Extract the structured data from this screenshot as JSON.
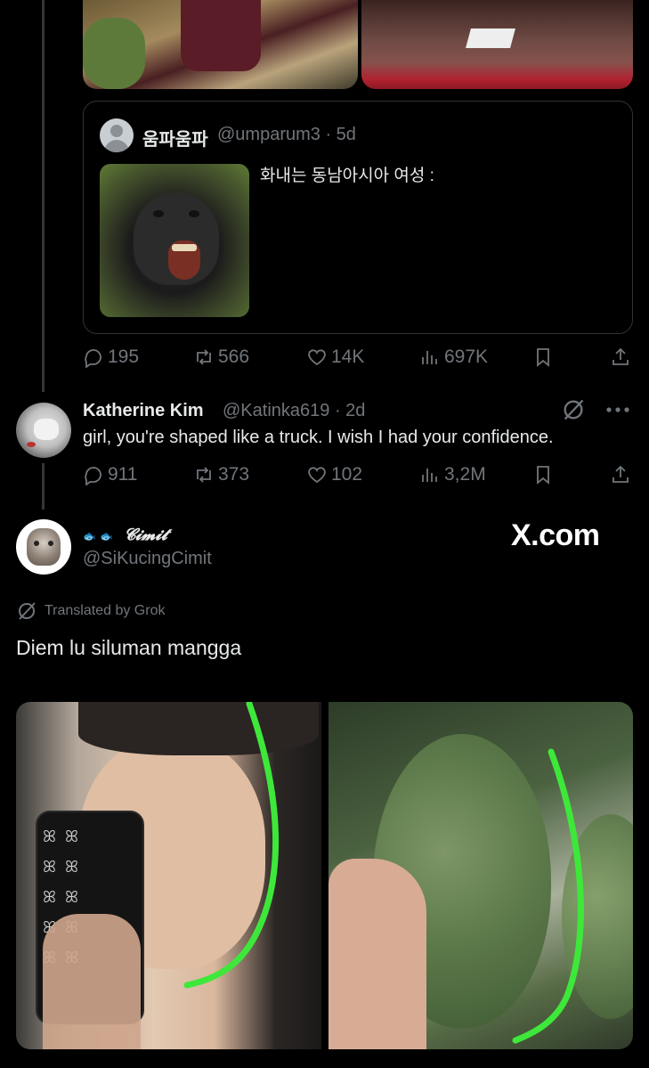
{
  "quote": {
    "name": "움파움파",
    "handle": "@umparum3 · 5d",
    "text": "화내는 동남아시아 여성 :"
  },
  "main_actions": {
    "replies": "195",
    "reposts": "566",
    "likes": "14K",
    "views": "697K"
  },
  "reply1": {
    "name": "Katherine Kim",
    "handle": "@Katinka619 · 2d",
    "text": "girl, you're shaped like a truck. I wish I had your confidence.",
    "actions": {
      "replies": "911",
      "reposts": "373",
      "likes": "102",
      "views": "3,2M"
    }
  },
  "reply2": {
    "name": "𝓒𝓲𝓶𝓲𝓽",
    "name_decoration": "🐟 🐟",
    "handle": "@SiKucingCimit",
    "translated_label": "Translated by Grok",
    "text": "Diem lu siluman mangga"
  },
  "watermark": "X.com",
  "colors": {
    "background": "#000000",
    "text": "#e7e9ea",
    "muted": "#71767b",
    "border": "#2f3336",
    "highlight_curve": "#3ee83a"
  }
}
